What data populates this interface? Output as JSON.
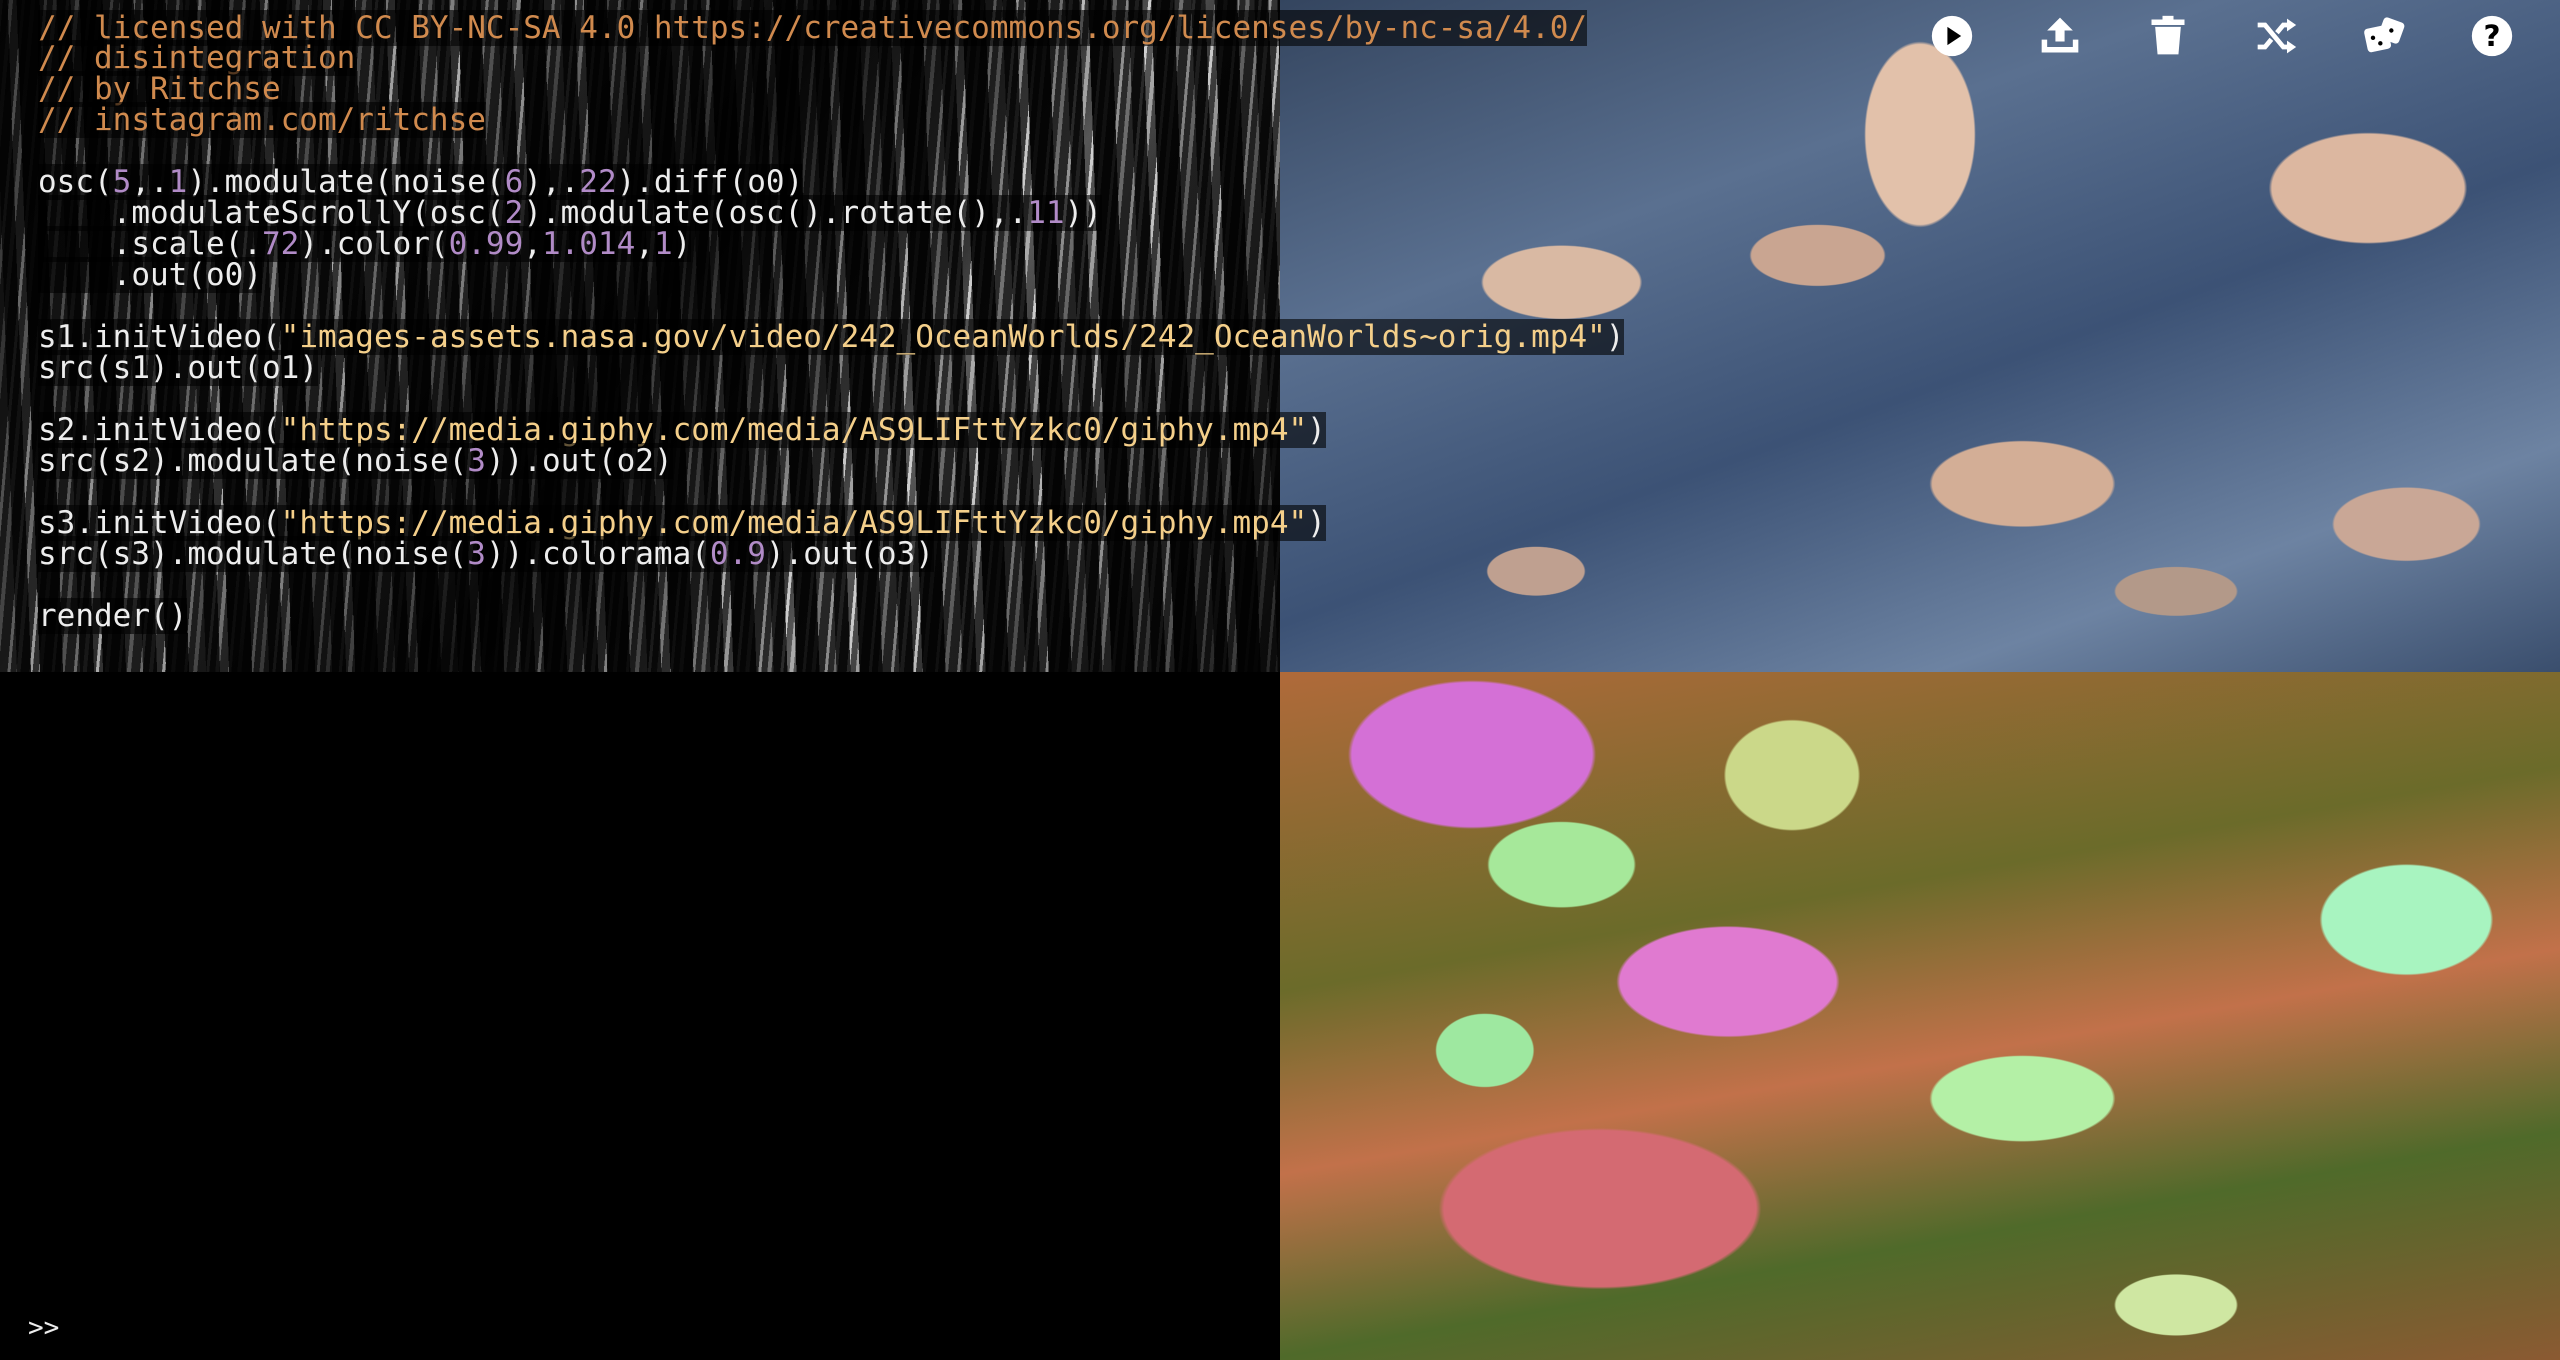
{
  "app": {
    "toolbar": [
      {
        "name": "run",
        "icon": "play-icon"
      },
      {
        "name": "share",
        "icon": "upload-icon"
      },
      {
        "name": "clear",
        "icon": "trash-icon"
      },
      {
        "name": "shuffle",
        "icon": "shuffle-icon"
      },
      {
        "name": "random",
        "icon": "dice-icon"
      },
      {
        "name": "help",
        "icon": "help-icon"
      }
    ]
  },
  "editor": {
    "lines": [
      {
        "text": "// licensed with CC BY-NC-SA 4.0 https://creativecommons.org/licenses/by-nc-sa/4.0/"
      },
      {
        "text": "// disintegration"
      },
      {
        "text": "// by Ritchse"
      },
      {
        "text": "// instagram.com/ritchse"
      },
      {
        "text": ""
      },
      {
        "text": "osc(5,.1).modulate(noise(6),.22).diff(o0)"
      },
      {
        "text": "    .modulateScrollY(osc(2).modulate(osc().rotate(),.11))"
      },
      {
        "text": "    .scale(.72).color(0.99,1.014,1)"
      },
      {
        "text": "    .out(o0)"
      },
      {
        "text": ""
      },
      {
        "text": "s1.initVideo(\"images-assets.nasa.gov/video/242_OceanWorlds/242_OceanWorlds~orig.mp4\")"
      },
      {
        "text": "src(s1).out(o1)"
      },
      {
        "text": ""
      },
      {
        "text": "s2.initVideo(\"https://media.giphy.com/media/AS9LIFttYzkc0/giphy.mp4\")"
      },
      {
        "text": "src(s2).modulate(noise(3)).out(o2)"
      },
      {
        "text": ""
      },
      {
        "text": "s3.initVideo(\"https://media.giphy.com/media/AS9LIFttYzkc0/giphy.mp4\")"
      },
      {
        "text": "src(s3).modulate(noise(3)).colorama(0.9).out(o3)"
      },
      {
        "text": ""
      },
      {
        "text": "render()"
      }
    ],
    "prompt": ">>"
  },
  "colors": {
    "comment": "#d08a4e",
    "number": "#b18bc7",
    "string": "#f4cf8a",
    "text": "#ededed"
  }
}
